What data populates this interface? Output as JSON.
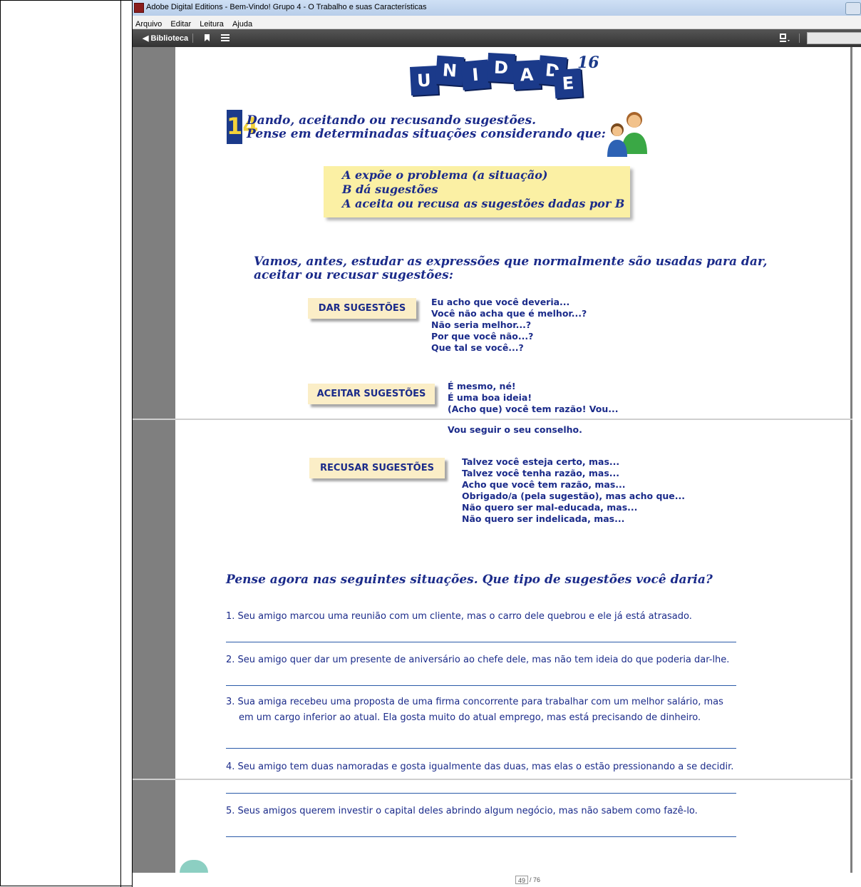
{
  "window": {
    "title": "Adobe Digital Editions - Bem-Vindo! Grupo 4 - O Trabalho e suas Características"
  },
  "menu": [
    "Arquivo",
    "Editar",
    "Leitura",
    "Ajuda"
  ],
  "toolbar": {
    "back_label": "◀ Biblioteca"
  },
  "book": {
    "unidade_letters": [
      "U",
      "N",
      "I",
      "D",
      "A",
      "D",
      "E"
    ],
    "unidade_number": "16",
    "section_number": "14",
    "section_line1": "Dando, aceitando ou recusando sugestões.",
    "section_line2": "Pense em determinadas situações considerando que:",
    "box_lines": [
      "A expõe o problema (a situação)",
      "B dá sugestões",
      "A aceita ou recusa as sugestões dadas por B"
    ],
    "intro_line1": "Vamos, antes, estudar as expressões que normalmente são usadas para dar,",
    "intro_line2": "aceitar ou recusar sugestões:",
    "categories": [
      {
        "label": "DAR SUGESTÕES",
        "expressions": [
          "Eu acho que você deveria...",
          "Você não acha que é melhor...?",
          "Não seria melhor...?",
          "Por que você não...?",
          "Que tal se você...?"
        ]
      },
      {
        "label": "ACEITAR SUGESTÕES",
        "expressions": [
          "É mesmo, né!",
          "É uma boa ideia!",
          "(Acho que) você tem razão! Vou...",
          "Vou seguir o seu conselho."
        ]
      },
      {
        "label": "RECUSAR SUGESTÕES",
        "expressions": [
          "Talvez você esteja certo, mas...",
          "Talvez você tenha razão, mas...",
          "Acho que você tem razão, mas...",
          "Obrigado/a (pela sugestão), mas acho que...",
          "Não quero ser mal-educada, mas...",
          "Não quero ser indelicada, mas..."
        ]
      }
    ],
    "question_title": "Pense agora nas seguintes situações. Que tipo de sugestões você daria?",
    "questions": [
      "1. Seu amigo marcou uma reunião com um cliente, mas o carro dele quebrou e ele já está atrasado.",
      "2. Seu amigo quer dar um presente de aniversário ao chefe dele, mas não tem ideia do que poderia dar-lhe.",
      "3. Sua amiga recebeu uma proposta de uma firma concorrente para trabalhar com um melhor salário, mas",
      "em um cargo inferior ao atual. Ela gosta muito do atual emprego, mas está precisando de dinheiro.",
      "4. Seu amigo tem duas namoradas e gosta igualmente das duas, mas elas o estão pressionando a se decidir.",
      "5. Seus amigos querem investir o capital deles abrindo algum negócio, mas não sabem como fazê-lo."
    ]
  },
  "status": {
    "current_page": "49",
    "total_pages": "/ 76"
  },
  "colors": {
    "ink": "#1b2b8a",
    "unidade_box": "#1b3a8a",
    "note_yellow": "#fbf0a4",
    "tag_bg": "#fbeec7",
    "gutter": "#7f7f7f"
  }
}
